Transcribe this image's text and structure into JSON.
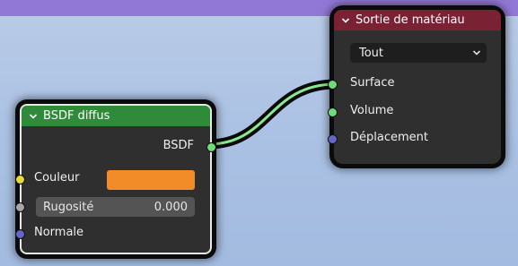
{
  "colors": {
    "background_top": "#9278d6",
    "canvas": "#aec4e6",
    "shader_header": "#2f8a3a",
    "output_header": "#7a2233",
    "color_value": "#f28c28",
    "socket_shader": "#6fdc7a",
    "socket_color": "#e6d93b",
    "socket_float": "#a6a6a6",
    "socket_vector": "#6565c8"
  },
  "nodes": {
    "bsdf": {
      "title": "BSDF diffus",
      "output_label": "BSDF",
      "inputs": {
        "color_label": "Couleur",
        "roughness_label": "Rugosité",
        "roughness_value": "0.000",
        "normal_label": "Normale"
      }
    },
    "output": {
      "title": "Sortie de matériau",
      "target_selected": "Tout",
      "inputs": {
        "surface_label": "Surface",
        "volume_label": "Volume",
        "displacement_label": "Déplacement"
      }
    }
  }
}
